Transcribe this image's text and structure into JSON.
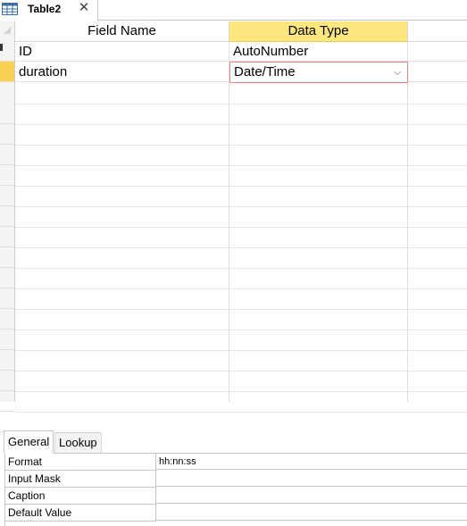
{
  "document_tab": {
    "title": "Table2",
    "close": "✕"
  },
  "grid": {
    "columns": [
      {
        "label": "Field Name",
        "active": false
      },
      {
        "label": "Data Type",
        "active": true
      }
    ],
    "rows": [
      {
        "field_name": "ID",
        "data_type": "AutoNumber",
        "primary_key": true,
        "current": false
      },
      {
        "field_name": "duration",
        "data_type": "Date/Time",
        "primary_key": false,
        "current": true
      }
    ],
    "dropdown_glyph": "⌵"
  },
  "properties": {
    "tabs": [
      "General",
      "Lookup"
    ],
    "active_tab": "General",
    "rows": [
      {
        "label": "Format",
        "value": "hh:nn:ss"
      },
      {
        "label": "Input Mask",
        "value": ""
      },
      {
        "label": "Caption",
        "value": ""
      },
      {
        "label": "Default Value",
        "value": ""
      }
    ]
  },
  "colors": {
    "active_header": "#fde77e",
    "current_row_selector": "#f9d153",
    "edit_border": "#e58585"
  }
}
